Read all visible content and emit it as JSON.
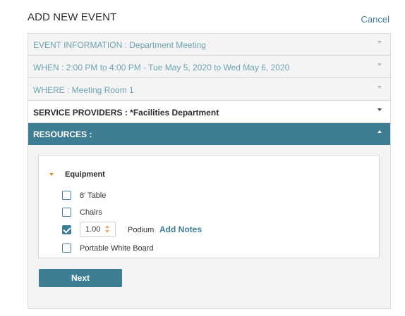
{
  "header": {
    "title": "ADD NEW EVENT",
    "cancel_label": "Cancel"
  },
  "sections": {
    "event_info": "EVENT INFORMATION : Department Meeting",
    "when": "WHEN : 2:00 PM to 4:00 PM - Tue May 5, 2020 to Wed May 6, 2020",
    "where": "WHERE : Meeting Room 1",
    "service_providers": "SERVICE PROVIDERS : *Facilities Department",
    "resources": "RESOURCES :"
  },
  "equipment": {
    "label": "Equipment",
    "items": [
      {
        "label": "8' Table",
        "checked": false
      },
      {
        "label": "Chairs",
        "checked": false
      },
      {
        "label": "Podium",
        "checked": true,
        "quantity": "1.00",
        "add_notes": "Add Notes"
      },
      {
        "label": "Portable White Board",
        "checked": false
      }
    ]
  },
  "actions": {
    "next_label": "Next"
  },
  "colors": {
    "accent": "#3f7d95",
    "muted_text": "#6fa3b3",
    "spinner": "#e9a27a",
    "tree_arrow": "#e08a2c"
  }
}
